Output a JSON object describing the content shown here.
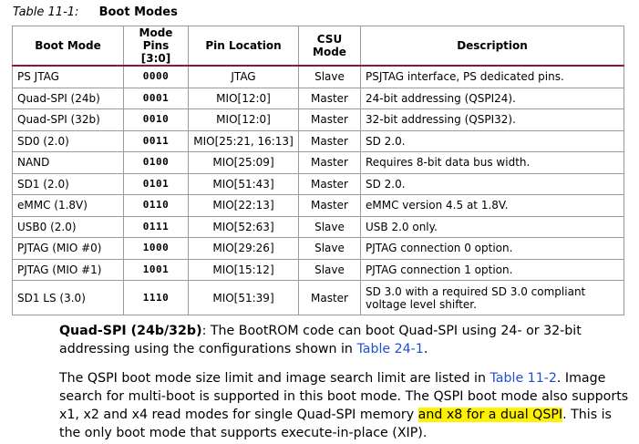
{
  "caption": {
    "label": "Table 11-1:",
    "title": "Boot Modes"
  },
  "table": {
    "headers": {
      "boot_mode": "Boot Mode",
      "mode_pins_line1": "Mode Pins",
      "mode_pins_line2": "[3:0]",
      "pin_location": "Pin Location",
      "csu_mode": "CSU Mode",
      "description": "Description"
    },
    "rows": [
      {
        "boot_mode": "PS JTAG",
        "mode_pins": "0000",
        "pin_location": "JTAG",
        "csu_mode": "Slave",
        "description": "PSJTAG interface, PS dedicated pins."
      },
      {
        "boot_mode": "Quad-SPI (24b)",
        "mode_pins": "0001",
        "pin_location": "MIO[12:0]",
        "csu_mode": "Master",
        "description": "24-bit addressing (QSPI24)."
      },
      {
        "boot_mode": "Quad-SPI (32b)",
        "mode_pins": "0010",
        "pin_location": "MIO[12:0]",
        "csu_mode": "Master",
        "description": "32-bit addressing (QSPI32)."
      },
      {
        "boot_mode": "SD0 (2.0)",
        "mode_pins": "0011",
        "pin_location": "MIO[25:21, 16:13]",
        "csu_mode": "Master",
        "description": "SD 2.0."
      },
      {
        "boot_mode": "NAND",
        "mode_pins": "0100",
        "pin_location": "MIO[25:09]",
        "csu_mode": "Master",
        "description": "Requires 8-bit data bus width."
      },
      {
        "boot_mode": "SD1 (2.0)",
        "mode_pins": "0101",
        "pin_location": "MIO[51:43]",
        "csu_mode": "Master",
        "description": "SD 2.0."
      },
      {
        "boot_mode": "eMMC (1.8V)",
        "mode_pins": "0110",
        "pin_location": "MIO[22:13]",
        "csu_mode": "Master",
        "description": "eMMC version 4.5 at 1.8V."
      },
      {
        "boot_mode": "USB0 (2.0)",
        "mode_pins": "0111",
        "pin_location": "MIO[52:63]",
        "csu_mode": "Slave",
        "description": "USB 2.0 only."
      },
      {
        "boot_mode": "PJTAG (MIO #0)",
        "mode_pins": "1000",
        "pin_location": "MIO[29:26]",
        "csu_mode": "Slave",
        "description": "PJTAG connection 0 option."
      },
      {
        "boot_mode": "PJTAG (MIO #1)",
        "mode_pins": "1001",
        "pin_location": "MIO[15:12]",
        "csu_mode": "Slave",
        "description": "PJTAG connection 1 option."
      },
      {
        "boot_mode": "SD1 LS (3.0)",
        "mode_pins": "1110",
        "pin_location": "MIO[51:39]",
        "csu_mode": "Master",
        "description": "SD 3.0 with a required SD 3.0 compliant voltage level shifter."
      }
    ]
  },
  "paragraph1": {
    "lead": "Quad-SPI (24b/32b)",
    "text_a": ": The BootROM code can boot Quad-SPI using 24- or 32-bit addressing using the configurations shown in ",
    "link": "Table 24-1",
    "text_b": "."
  },
  "paragraph2": {
    "text_a": "The QSPI boot mode size limit and image search limit are listed in ",
    "link": "Table 11-2",
    "text_b": ". Image search for multi-boot is supported in this boot mode. The QSPI boot mode also supports x1, x2 and x4 read modes for single Quad-SPI memory ",
    "highlight": "and x8 for a dual QSPI",
    "text_c": ". This is the only boot mode that supports execute-in-place (XIP)."
  },
  "colors": {
    "header_rule": "#8b1a3a",
    "link": "#1f4fd6",
    "highlight": "#fff200"
  }
}
